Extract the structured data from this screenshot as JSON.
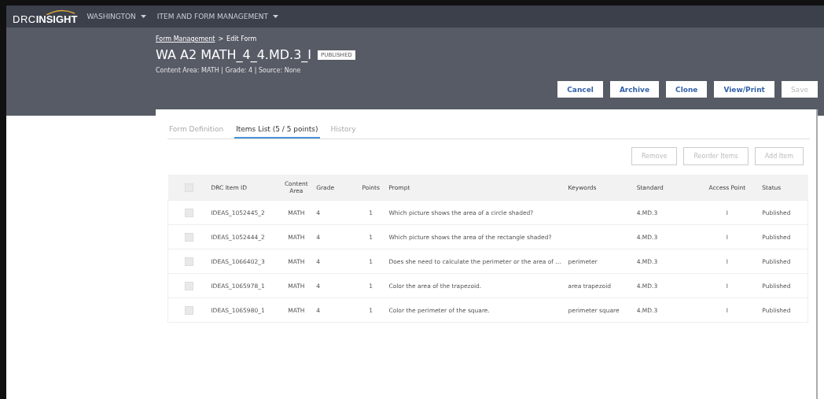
{
  "navbar": {
    "logo": {
      "prefix": "DRC",
      "main": "INSIGHT"
    },
    "menus": [
      {
        "label": "WASHINGTON"
      },
      {
        "label": "ITEM AND FORM MANAGEMENT"
      }
    ]
  },
  "breadcrumb": {
    "link": "Form Management",
    "separator": ">",
    "current": "Edit Form"
  },
  "form": {
    "title": "WA A2 MATH_4_4.MD.3_I",
    "status_badge": "PUBLISHED",
    "meta": "Content Area: MATH | Grade: 4 | Source: None"
  },
  "header_buttons": [
    {
      "label": "Cancel",
      "disabled": false
    },
    {
      "label": "Archive",
      "disabled": false
    },
    {
      "label": "Clone",
      "disabled": false
    },
    {
      "label": "View/Print",
      "disabled": false
    },
    {
      "label": "Save",
      "disabled": true
    }
  ],
  "tabs": [
    {
      "label": "Form Definition",
      "selected": false
    },
    {
      "label": "Items List (5 / 5 points)",
      "selected": true
    },
    {
      "label": "History",
      "selected": false
    }
  ],
  "list_buttons": [
    {
      "label": "Remove",
      "disabled": true
    },
    {
      "label": "Reorder Items",
      "disabled": true
    },
    {
      "label": "Add Item",
      "disabled": true
    }
  ],
  "table": {
    "select_all_checked": false,
    "columns": [
      "DRC Item ID",
      "Content Area",
      "Grade",
      "Points",
      "Prompt",
      "Keywords",
      "Standard",
      "Access Point",
      "Status"
    ],
    "rows": [
      {
        "checked": false,
        "cells": [
          "IDEAS_1052445_2",
          "MATH",
          "4",
          "1",
          "Which picture shows the area of a circle shaded?",
          "",
          "4.MD.3",
          "I",
          "Published"
        ]
      },
      {
        "checked": false,
        "cells": [
          "IDEAS_1052444_2",
          "MATH",
          "4",
          "1",
          "Which picture shows the area of the rectangle shaded?",
          "",
          "4.MD.3",
          "I",
          "Published"
        ]
      },
      {
        "checked": false,
        "cells": [
          "IDEAS_1066402_3",
          "MATH",
          "4",
          "1",
          "Does she need to calculate the perimeter or the area of …",
          "perimeter",
          "4.MD.3",
          "I",
          "Published"
        ]
      },
      {
        "checked": false,
        "cells": [
          "IDEAS_1065978_1",
          "MATH",
          "4",
          "1",
          "Color the area of the trapezoid.",
          "area trapezoid",
          "4.MD.3",
          "I",
          "Published"
        ]
      },
      {
        "checked": false,
        "cells": [
          "IDEAS_1065980_1",
          "MATH",
          "4",
          "1",
          "Color the perimeter of the square.",
          "perimeter square",
          "4.MD.3",
          "I",
          "Published"
        ]
      }
    ]
  }
}
